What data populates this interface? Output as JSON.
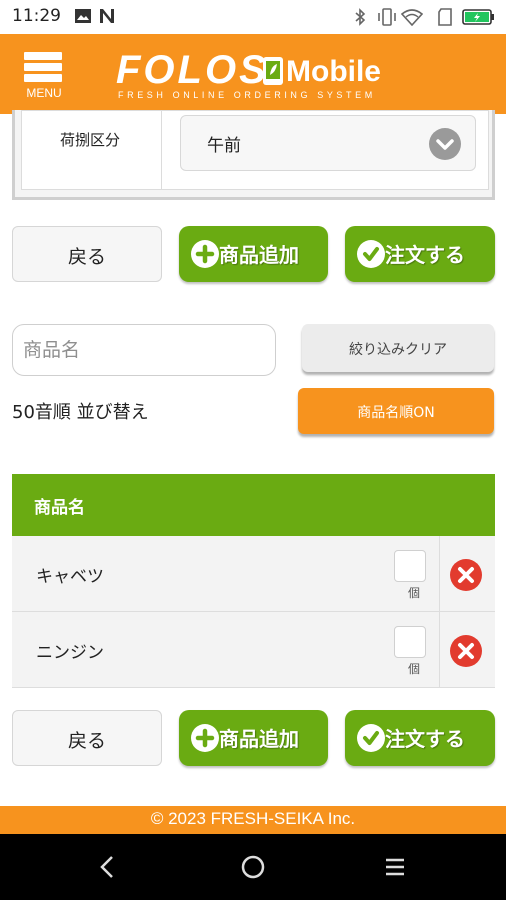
{
  "status_bar": {
    "time": "11:29",
    "left_icons": [
      "image-icon",
      "n-icon"
    ],
    "right_icons": [
      "bluetooth-icon",
      "vibrate-icon",
      "wifi-icon",
      "sim-icon",
      "battery-icon"
    ],
    "battery_color": "#22c55e"
  },
  "app_header": {
    "menu_label": "MENU",
    "logo_text": "FOLOS",
    "logo_suffix": "Mobile",
    "logo_tagline": "FRESH ONLINE ORDERING SYSTEM",
    "brand_color": "#F7931E"
  },
  "delivery": {
    "label": "荷捌区分",
    "selected": "午前"
  },
  "actions": {
    "back_label": "戻る",
    "add_label": "商品追加",
    "order_label": "注文する",
    "accent_color": "#6AAB12"
  },
  "filter": {
    "search_placeholder": "商品名",
    "clear_label": "絞り込みクリア",
    "sort_label": "50音順 並び替え",
    "sort_button_label": "商品名順ON"
  },
  "table": {
    "header": "商品名",
    "rows": [
      {
        "name": "キャベツ",
        "unit": "個"
      },
      {
        "name": "ニンジン",
        "unit": "個"
      }
    ]
  },
  "footer": {
    "copyright": "© 2023 FRESH-SEIKA Inc."
  }
}
